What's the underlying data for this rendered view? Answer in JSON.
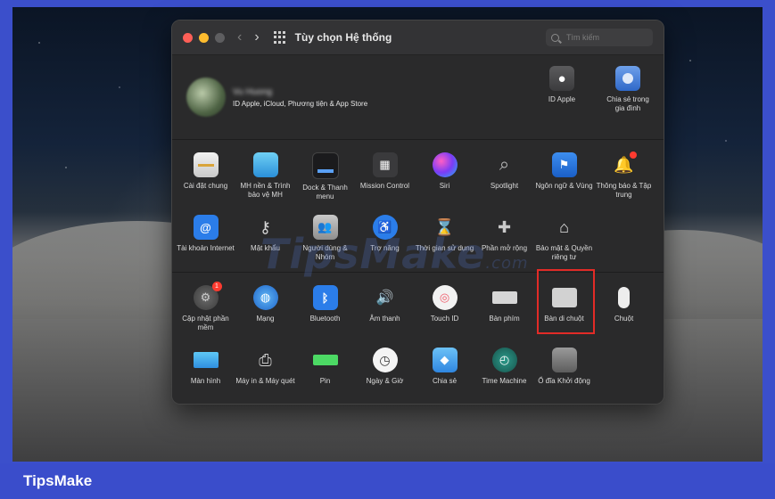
{
  "window": {
    "title": "Tùy chọn Hệ thống",
    "search_placeholder": "Tìm kiếm",
    "nav_back": "‹",
    "nav_forward": "›"
  },
  "account": {
    "name": "Vu Huong",
    "subtitle": "ID Apple, iCloud, Phương tiện & App Store",
    "apple_id_label": "ID Apple",
    "family_label": "Chia sẻ trong gia đình"
  },
  "prefs": {
    "row1": [
      {
        "label": "Cài đặt chung"
      },
      {
        "label": "MH nền & Trình bảo vệ MH"
      },
      {
        "label": "Dock & Thanh menu"
      },
      {
        "label": "Mission Control"
      },
      {
        "label": "Siri"
      },
      {
        "label": "Spotlight"
      },
      {
        "label": "Ngôn ngữ & Vùng"
      },
      {
        "label": "Thông báo & Tập trung"
      }
    ],
    "row2": [
      {
        "label": "Tài khoản Internet"
      },
      {
        "label": "Mật khẩu"
      },
      {
        "label": "Người dùng & Nhóm"
      },
      {
        "label": "Trợ năng"
      },
      {
        "label": "Thời gian sử dụng"
      },
      {
        "label": "Phần mở rộng"
      },
      {
        "label": "Bảo mật & Quyền riêng tư"
      }
    ],
    "row3": [
      {
        "label": "Cập nhật phần mềm",
        "badge": "1"
      },
      {
        "label": "Mạng"
      },
      {
        "label": "Bluetooth"
      },
      {
        "label": "Âm thanh"
      },
      {
        "label": "Touch ID"
      },
      {
        "label": "Bàn phím"
      },
      {
        "label": "Bàn di chuột"
      },
      {
        "label": "Chuột"
      }
    ],
    "row4": [
      {
        "label": "Màn hình"
      },
      {
        "label": "Máy in & Máy quét"
      },
      {
        "label": "Pin"
      },
      {
        "label": "Ngày & Giờ"
      },
      {
        "label": "Chia sẻ"
      },
      {
        "label": "Time Machine"
      },
      {
        "label": "Ổ đĩa Khởi động"
      }
    ]
  },
  "watermark": {
    "main": "TipsMake",
    "suffix": ".com"
  },
  "footer": {
    "brand": "TipsMake"
  }
}
